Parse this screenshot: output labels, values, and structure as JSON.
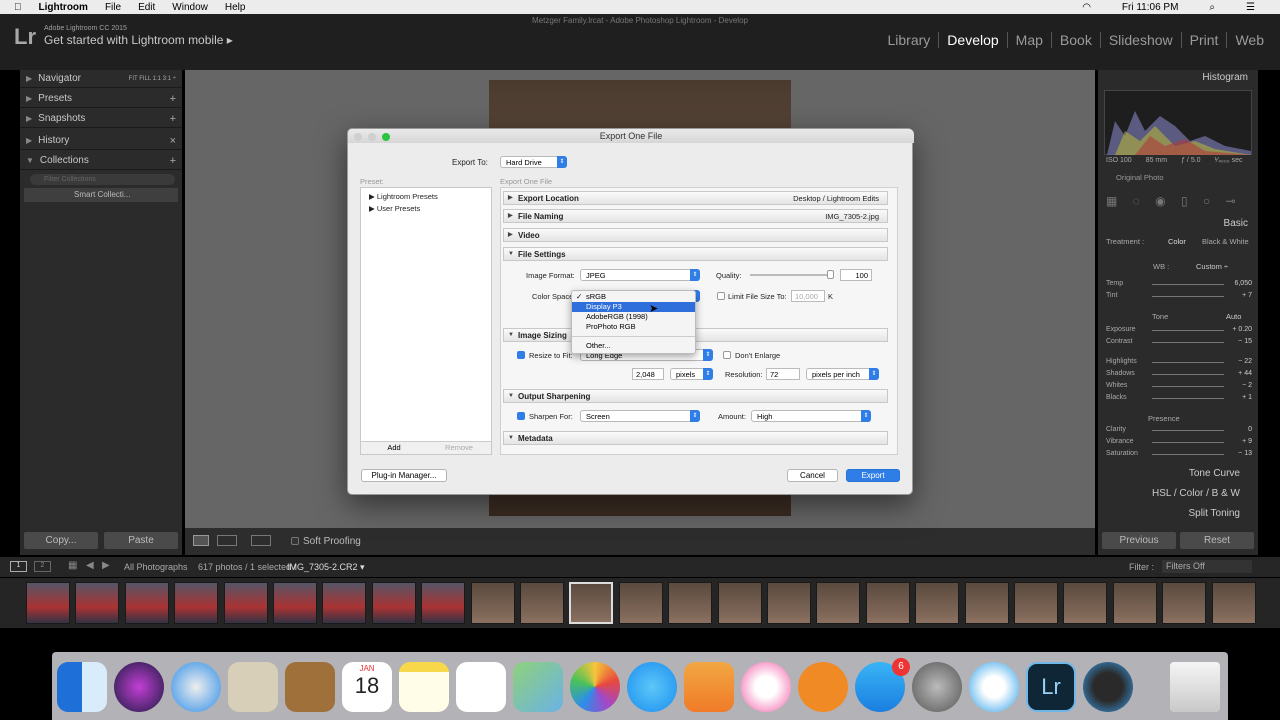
{
  "menubar": {
    "app": "Lightroom",
    "items": [
      "File",
      "Edit",
      "Window",
      "Help"
    ],
    "clock": "Fri 11:06 PM"
  },
  "window_title": "Metzger Family.lrcat - Adobe Photoshop Lightroom - Develop",
  "lr_header": {
    "logo": "Lr",
    "product": "Adobe Lightroom CC 2015",
    "mobile": "Get started with Lightroom mobile ▸",
    "modules": [
      "Library",
      "Develop",
      "Map",
      "Book",
      "Slideshow",
      "Print",
      "Web"
    ],
    "active": "Develop"
  },
  "left_panel": {
    "navigator": "Navigator",
    "nav_zoom": "FIT  FILL  1:1  3:1 ÷",
    "presets": "Presets",
    "snapshots": "Snapshots",
    "history": "History",
    "collections": "Collections",
    "filter_placeholder": "Filter Collections",
    "smart": "Smart Collecti...",
    "copy": "Copy...",
    "paste": "Paste"
  },
  "right_panel": {
    "histogram": "Histogram",
    "iso": "ISO 100",
    "mm": "85 mm",
    "f": "ƒ / 5.0",
    "sec": "¹⁄₄₀₀₀ sec",
    "original": "Original Photo",
    "basic": "Basic",
    "treatment": "Treatment :",
    "color": "Color",
    "bw": "Black & White",
    "wb": "WB :",
    "wb_val": "Custom ÷",
    "tone": "Tone",
    "auto": "Auto",
    "presence": "Presence",
    "sliders": [
      {
        "l": "Temp",
        "v": "6,050"
      },
      {
        "l": "Tint",
        "v": "+ 7"
      },
      {
        "l": "Exposure",
        "v": "+ 0.20"
      },
      {
        "l": "Contrast",
        "v": "− 15"
      },
      {
        "l": "Highlights",
        "v": "− 22"
      },
      {
        "l": "Shadows",
        "v": "+ 44"
      },
      {
        "l": "Whites",
        "v": "− 2"
      },
      {
        "l": "Blacks",
        "v": "+ 1"
      },
      {
        "l": "Clarity",
        "v": "0"
      },
      {
        "l": "Vibrance",
        "v": "+ 9"
      },
      {
        "l": "Saturation",
        "v": "− 13"
      }
    ],
    "tone_curve": "Tone Curve",
    "hsl": "HSL  /  Color  /  B & W",
    "split": "Split Toning",
    "previous": "Previous",
    "reset": "Reset"
  },
  "toolbar": {
    "soft_proofing": "Soft Proofing"
  },
  "filmstrip": {
    "source": "All Photographs",
    "count": "617 photos / 1 selected /",
    "file": "IMG_7305-2.CR2 ▾",
    "filter": "Filter :",
    "filter_val": "Filters Off"
  },
  "dialog": {
    "title": "Export One File",
    "export_to_label": "Export To:",
    "export_to": "Hard Drive",
    "preset_label": "Preset:",
    "export_one_file": "Export One File",
    "presets": [
      "Lightroom Presets",
      "User Presets"
    ],
    "add": "Add",
    "remove": "Remove",
    "plugin": "Plug-in Manager...",
    "cancel": "Cancel",
    "export": "Export",
    "sections": {
      "loc": "Export Location",
      "loc_val": "Desktop / Lightroom Edits",
      "naming": "File Naming",
      "naming_val": "IMG_7305-2.jpg",
      "video": "Video",
      "settings": "File Settings",
      "sizing": "Image Sizing",
      "sharpen": "Output Sharpening",
      "metadata": "Metadata"
    },
    "format_label": "Image Format:",
    "format": "JPEG",
    "quality_label": "Quality:",
    "quality": "100",
    "cs_label": "Color Space:",
    "limit_label": "Limit File Size To:",
    "limit_val": "10,000",
    "limit_unit": "K",
    "resize_label": "Resize to Fit:",
    "resize": "Long Edge",
    "dont_enlarge": "Don't Enlarge",
    "px_val": "2,048",
    "px_unit": "pixels",
    "res_label": "Resolution:",
    "res_val": "72",
    "res_unit": "pixels per inch",
    "sharpen_label": "Sharpen For:",
    "sharpen": "Screen",
    "amount_label": "Amount:",
    "amount": "High",
    "popup": [
      "sRGB",
      "Display P3",
      "AdobeRGB (1998)",
      "ProPhoto RGB",
      "Other..."
    ]
  },
  "dock": {
    "calendar_month": "JAN",
    "calendar_day": "18",
    "appstore_badge": "6"
  }
}
